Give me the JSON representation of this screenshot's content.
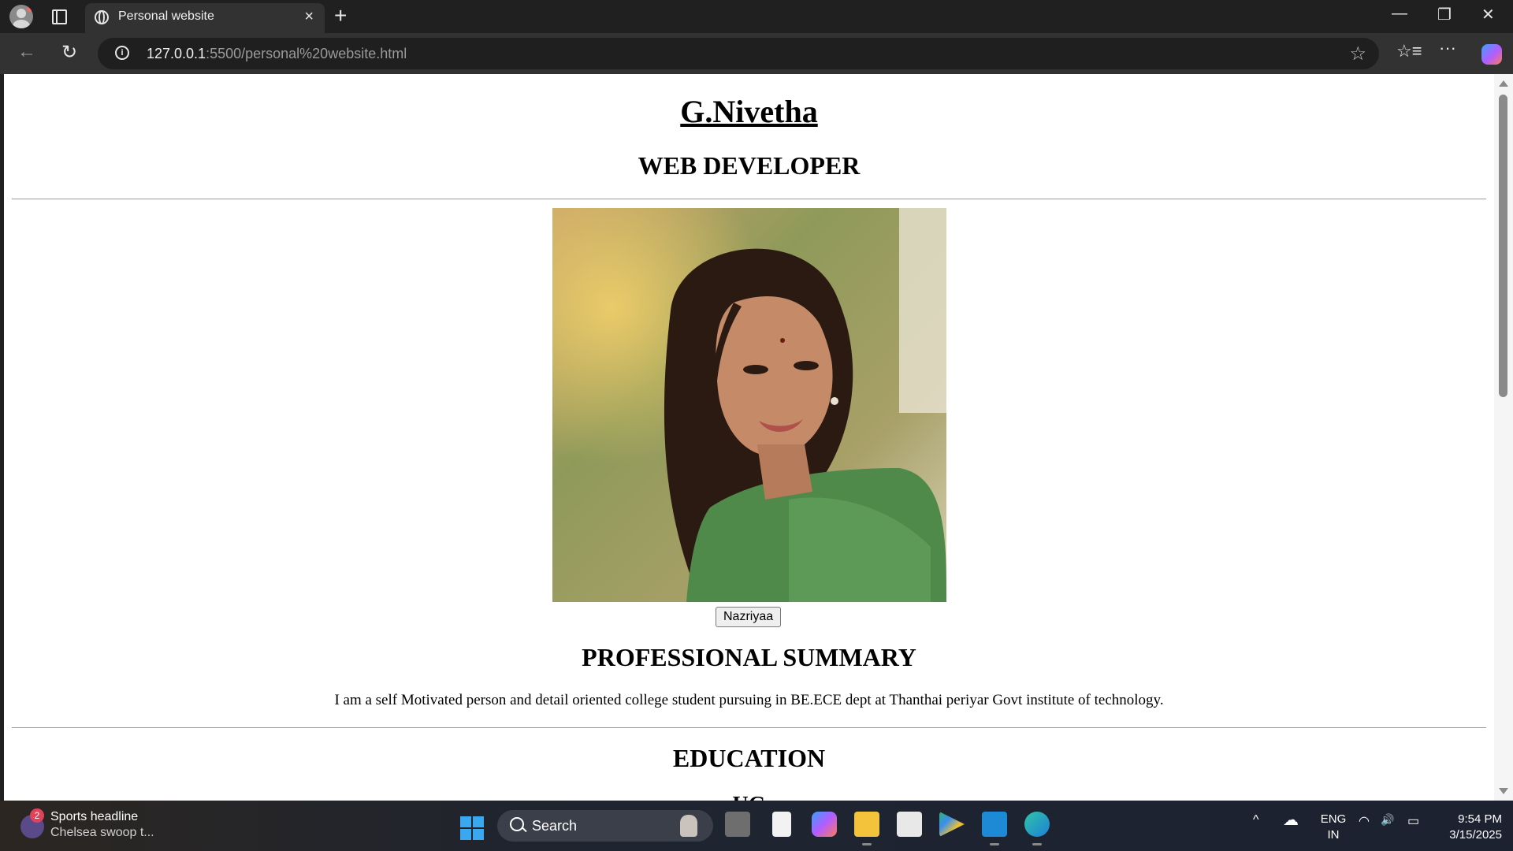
{
  "browser": {
    "tab_title": "Personal website",
    "tab_close": "×",
    "new_tab": "+",
    "url_host": "127.0.0.1",
    "url_path": ":5500/personal%20website.html",
    "info_glyph": "i",
    "back": "←",
    "reload": "↻",
    "favorites_star": "☆",
    "favorites_bar": "☆≡",
    "more": "···",
    "minimize": "—",
    "maximize": "❐",
    "close": "✕"
  },
  "page": {
    "name": "G.Nivetha",
    "role": "WEB DEVELOPER",
    "photo_alt": "Portrait photo",
    "photo_button": "Nazriyaa",
    "summary_heading": "PROFESSIONAL SUMMARY",
    "summary_text": "I am a self Motivated person and detail oriented college student pursuing in BE.ECE dept at Thanthai periyar Govt institute of technology.",
    "education_heading": "EDUCATION",
    "next_heading_partial": "UG"
  },
  "taskbar": {
    "news_badge": "2",
    "news_title": "Sports headline",
    "news_sub": "Chelsea swoop t...",
    "search_label": "Search",
    "lang_top": "ENG",
    "lang_bottom": "IN",
    "time": "9:54 PM",
    "date": "3/15/2025",
    "tray_chevron": "^",
    "tray_cloud": "☁",
    "tray_wifi": "◠",
    "tray_volume": "🔊",
    "tray_battery": "▭"
  },
  "colors": {
    "chrome_dark": "#202020",
    "toolbar": "#323232",
    "page_bg": "#ffffff",
    "accent_blue": "#3aa8f0"
  }
}
